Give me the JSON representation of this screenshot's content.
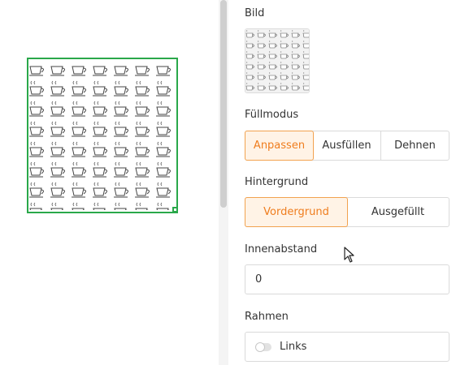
{
  "panel": {
    "image_label": "Bild",
    "fill_mode": {
      "label": "Füllmodus",
      "options": [
        "Anpassen",
        "Ausfüllen",
        "Dehnen"
      ],
      "selected": "Anpassen"
    },
    "background": {
      "label": "Hintergrund",
      "options": [
        "Vordergrund",
        "Ausgefüllt"
      ],
      "selected": "Vordergrund"
    },
    "padding": {
      "label": "Innenabstand",
      "value": "0"
    },
    "border": {
      "label": "Rahmen",
      "toggle_label": "Links",
      "toggle_on": false
    }
  },
  "colors": {
    "selection_border": "#2aa84a",
    "accent": "#ef7d1e",
    "accent_bg": "#fff3e6"
  },
  "icons": {
    "pattern": "coffee-cup-icon",
    "pointer": "mouse-pointer-icon"
  }
}
